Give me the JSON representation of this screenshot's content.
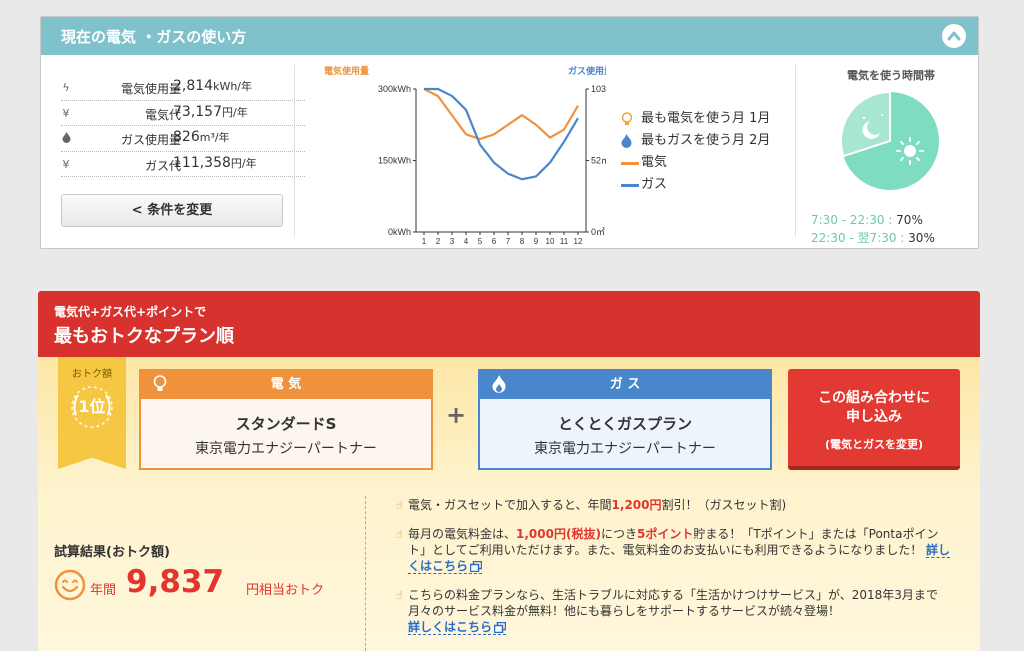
{
  "usage": {
    "title": "現在の電気 ・ガスの使い方",
    "stats": [
      {
        "icon": "lightning-icon",
        "label": "電気使用量",
        "value": "2,814",
        "unit": "kWh/年"
      },
      {
        "icon": "yen-icon",
        "label": "電気代",
        "value": "73,157",
        "unit": "円/年"
      },
      {
        "icon": "flame-icon",
        "label": "ガス使用量",
        "value": "826",
        "unit": "m³/年"
      },
      {
        "icon": "yen-icon",
        "label": "ガス代",
        "value": "111,358",
        "unit": "円/年"
      }
    ],
    "change_button": "<  条件を変更",
    "legend": {
      "max_elec": "最も電気を使う月 1月",
      "max_gas": "最もガスを使う月 2月",
      "elec": "電気",
      "gas": "ガス"
    },
    "timeband": {
      "title": "電気を使う時間帯",
      "day_range": "7:30 - 22:30",
      "day_pct": "70%",
      "night_range": "22:30 - 翌7:30",
      "night_pct": "30%",
      "day_fraction": 0.7,
      "night_fraction": 0.3
    }
  },
  "chart_data": {
    "type": "line",
    "x": [
      "1",
      "2",
      "3",
      "4",
      "5",
      "6",
      "7",
      "8",
      "9",
      "10",
      "11",
      "12"
    ],
    "left_axis": {
      "label": "電気使用量",
      "ticks": [
        "300kWh",
        "150kWh",
        "0kWh"
      ],
      "range": [
        0,
        300
      ]
    },
    "right_axis": {
      "label": "ガス使用量",
      "ticks": [
        "103㎥",
        "52㎥",
        "0㎥"
      ],
      "range": [
        0,
        103
      ]
    },
    "series": [
      {
        "name": "電気",
        "axis": "left",
        "color": "#f0923c",
        "values": [
          300,
          285,
          245,
          205,
          195,
          205,
          225,
          245,
          225,
          198,
          215,
          265
        ]
      },
      {
        "name": "ガス",
        "axis": "right",
        "color": "#4a86cc",
        "values": [
          103,
          103,
          98,
          88,
          63,
          50,
          42,
          38,
          40,
          50,
          65,
          82
        ]
      }
    ]
  },
  "plan": {
    "subtitle": "電気代+ガス代+ポイントで",
    "title": "最もおトクなプラン順",
    "rank_label": "おトク額",
    "rank": "1位",
    "electric": {
      "head": "電 気",
      "name": "スタンダードS",
      "company": "東京電力エナジーパートナー"
    },
    "gas": {
      "head": "ガ ス",
      "name": "とくとくガスプラン",
      "company": "東京電力エナジーパートナー"
    },
    "apply": {
      "line1": "この組み合わせに",
      "line2": "申し込み",
      "line3": "(電気とガスを変更)"
    },
    "result": {
      "title": "試算結果(おトク額)",
      "year": "年間",
      "amount": "9,837",
      "suffix": "円相当おトク"
    },
    "benefits": {
      "b1_pre": "電気・ガスセットで加入すると、年間",
      "b1_red": "1,200円",
      "b1_post": "割引！（ガスセット割)",
      "b2_pre": "毎月の電気料金は、",
      "b2_red1": "1,000円(税抜)",
      "b2_mid": "につき",
      "b2_red2": "5ポイント",
      "b2_post": "貯まる！「Tポイント」または「Pontaポイント」としてご利用いただけます。また、電気料金のお支払いにも利用できるようになりました！",
      "b3_text": "こちらの料金プランなら、生活トラブルに対応する「生活かけつけサービス」が、2018年3月まで月々のサービス料金が無料！他にも暮らしをサポートするサービスが続々登場！",
      "link": "詳しくはこちら"
    }
  }
}
